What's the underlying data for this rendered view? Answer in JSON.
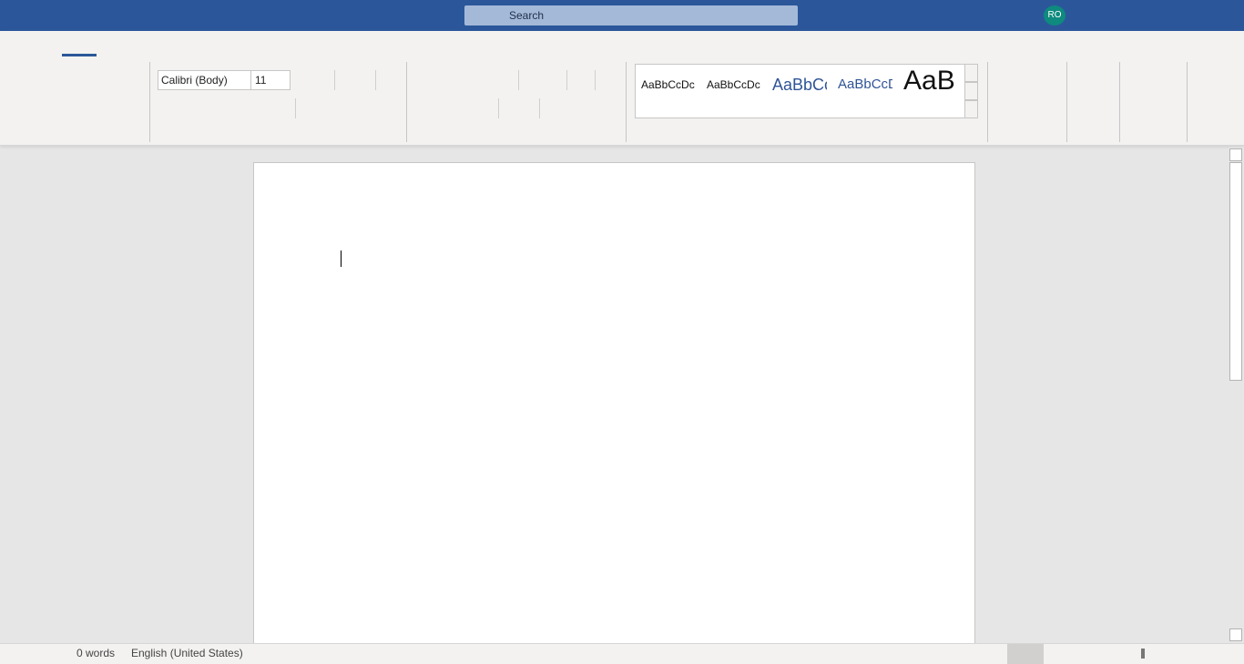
{
  "titlebar": {
    "search_label": "Search",
    "avatar_initials": "RO",
    "accent_color": "#2b579a"
  },
  "ribbon": {
    "font": {
      "name": "Calibri (Body)",
      "size": "11"
    },
    "styles": [
      {
        "sample": "AaBbCcDc",
        "color": "#111111"
      },
      {
        "sample": "AaBbCcDc",
        "color": "#111111"
      },
      {
        "sample": "AaBbCc",
        "color": "#2f5496"
      },
      {
        "sample": "AaBbCcD",
        "color": "#2f5496"
      },
      {
        "sample": "AaB",
        "color": "#111111"
      }
    ]
  },
  "statusbar": {
    "word_count": "0 words",
    "language": "English (United States)"
  }
}
